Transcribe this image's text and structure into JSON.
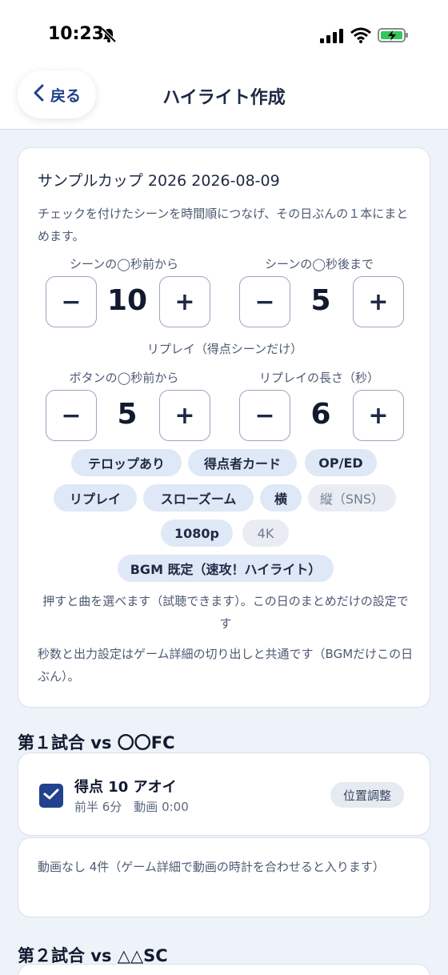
{
  "status": {
    "time": "10:23"
  },
  "header": {
    "back_label": "戻る",
    "title": "ハイライト作成"
  },
  "card": {
    "title": "サンプルカップ 2026 2026-08-09",
    "description": "チェックを付けたシーンを時間順につなげ、その日ぶんの１本にまとめます。",
    "steppers": [
      {
        "label": "シーンの◯秒前から",
        "value": "10"
      },
      {
        "label": "シーンの◯秒後まで",
        "value": "5"
      },
      {
        "label": "ボタンの◯秒前から",
        "value": "5"
      },
      {
        "label": "リプレイの長さ（秒）",
        "value": "6"
      }
    ],
    "minus": "−",
    "plus": "+",
    "replay_section": "リプレイ（得点シーンだけ）",
    "chips": [
      {
        "label": "テロップあり",
        "active": true
      },
      {
        "label": "得点者カード",
        "active": true
      },
      {
        "label": "OP/ED",
        "active": true
      },
      {
        "label": "リプレイ",
        "active": true
      },
      {
        "label": "スローズーム",
        "active": true
      },
      {
        "label": "横",
        "active": true
      },
      {
        "label": "縦（SNS）",
        "active": false
      },
      {
        "label": "1080p",
        "active": true
      },
      {
        "label": "4K",
        "active": false
      },
      {
        "label": "BGM 既定（速攻！ハイライト）",
        "active": true
      }
    ],
    "bgm_note": "押すと曲を選べます（試聴できます）。この日のまとめだけの設定です",
    "shared_note": "秒数と出力設定はゲーム詳細の切り出しと共通です（BGMだけこの日ぶん）。"
  },
  "games": [
    {
      "heading": "第１試合 vs 〇〇FC",
      "scene": {
        "title": "得点 10 アオイ",
        "sub": "前半 6分　動画 0:00",
        "adjust": "位置調整"
      },
      "no_video": "動画なし 4件（ゲーム詳細で動画の時計を合わせると入ります）"
    },
    {
      "heading": "第２試合 vs △△SC"
    }
  ],
  "colors": {
    "accent": "#22428f",
    "chip": "#dfe8f7",
    "background": "#eef2f9"
  }
}
